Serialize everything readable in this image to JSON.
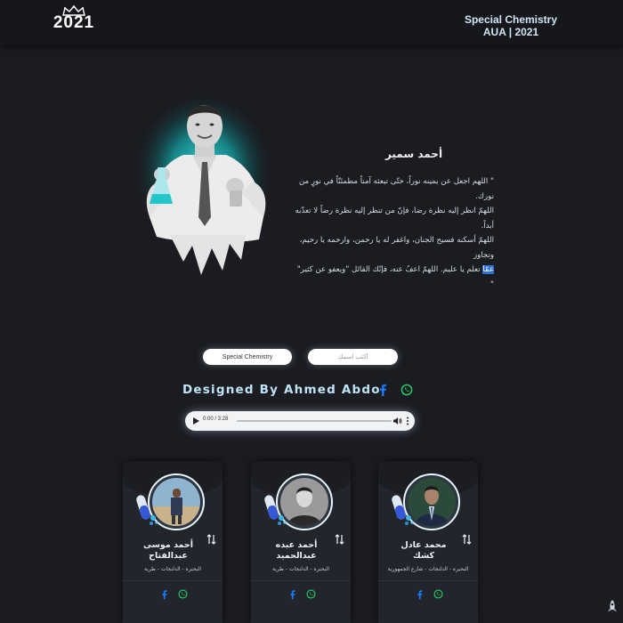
{
  "header": {
    "logo_text": "2021",
    "logo_icon": "crown-icon",
    "brand_line1": "Special Chemistry",
    "brand_line2": "AUA | 2021"
  },
  "hero": {
    "name": "أحمد سمير",
    "prayer_lines": [
      "\" اللهم اجعل عن يمينه نوراً، حتّى تبعثه آمناً مطمئنّاً في نورٍ من نورك.",
      "اللهمّ انظر إليه نظرة رضا، فإنّ من تنظر إليه نظرة رضاً لا تعذّبه أبداً.",
      "اللهمّ أسكنه فسيح الجنان، واغفر له يا رحمن، وارحمه يا رحيم، وتجاوز"
    ],
    "prayer_selected": "عمّا",
    "prayer_last": " تعلم يا عليم. اللهمّ اعفُ عنه، فإنّك القائل \"ويعفو عن كثير\" \""
  },
  "search": {
    "button_label": "Special Chemistry",
    "placeholder": "أكتب اسمك"
  },
  "credit": {
    "text": "Designed By Ahmed Abdo",
    "facebook_icon": "facebook-icon",
    "whatsapp_icon": "whatsapp-icon"
  },
  "audio": {
    "time": "0:00 / 3:28",
    "progress": 0.0
  },
  "cards": [
    {
      "name_line1": "أحمد موسى",
      "name_line2": "عبدالفتاح",
      "meta": "البحيره  -  الدلنجات  -  طرية"
    },
    {
      "name_line1": "أحمد عبده",
      "name_line2": "عبدالحميد",
      "meta": "البحيره  -  الدلنجات  -  طرية"
    },
    {
      "name_line1": "محمد عادل",
      "name_line2": "كشك",
      "meta": "البحيره  -  الدلنجات  -  شارع الجمهورية"
    }
  ],
  "colors": {
    "background": "#1b1c21",
    "header": "#16171b",
    "accent_cyan": "#1ec8c8",
    "facebook": "#1877f2",
    "whatsapp": "#25d366"
  }
}
